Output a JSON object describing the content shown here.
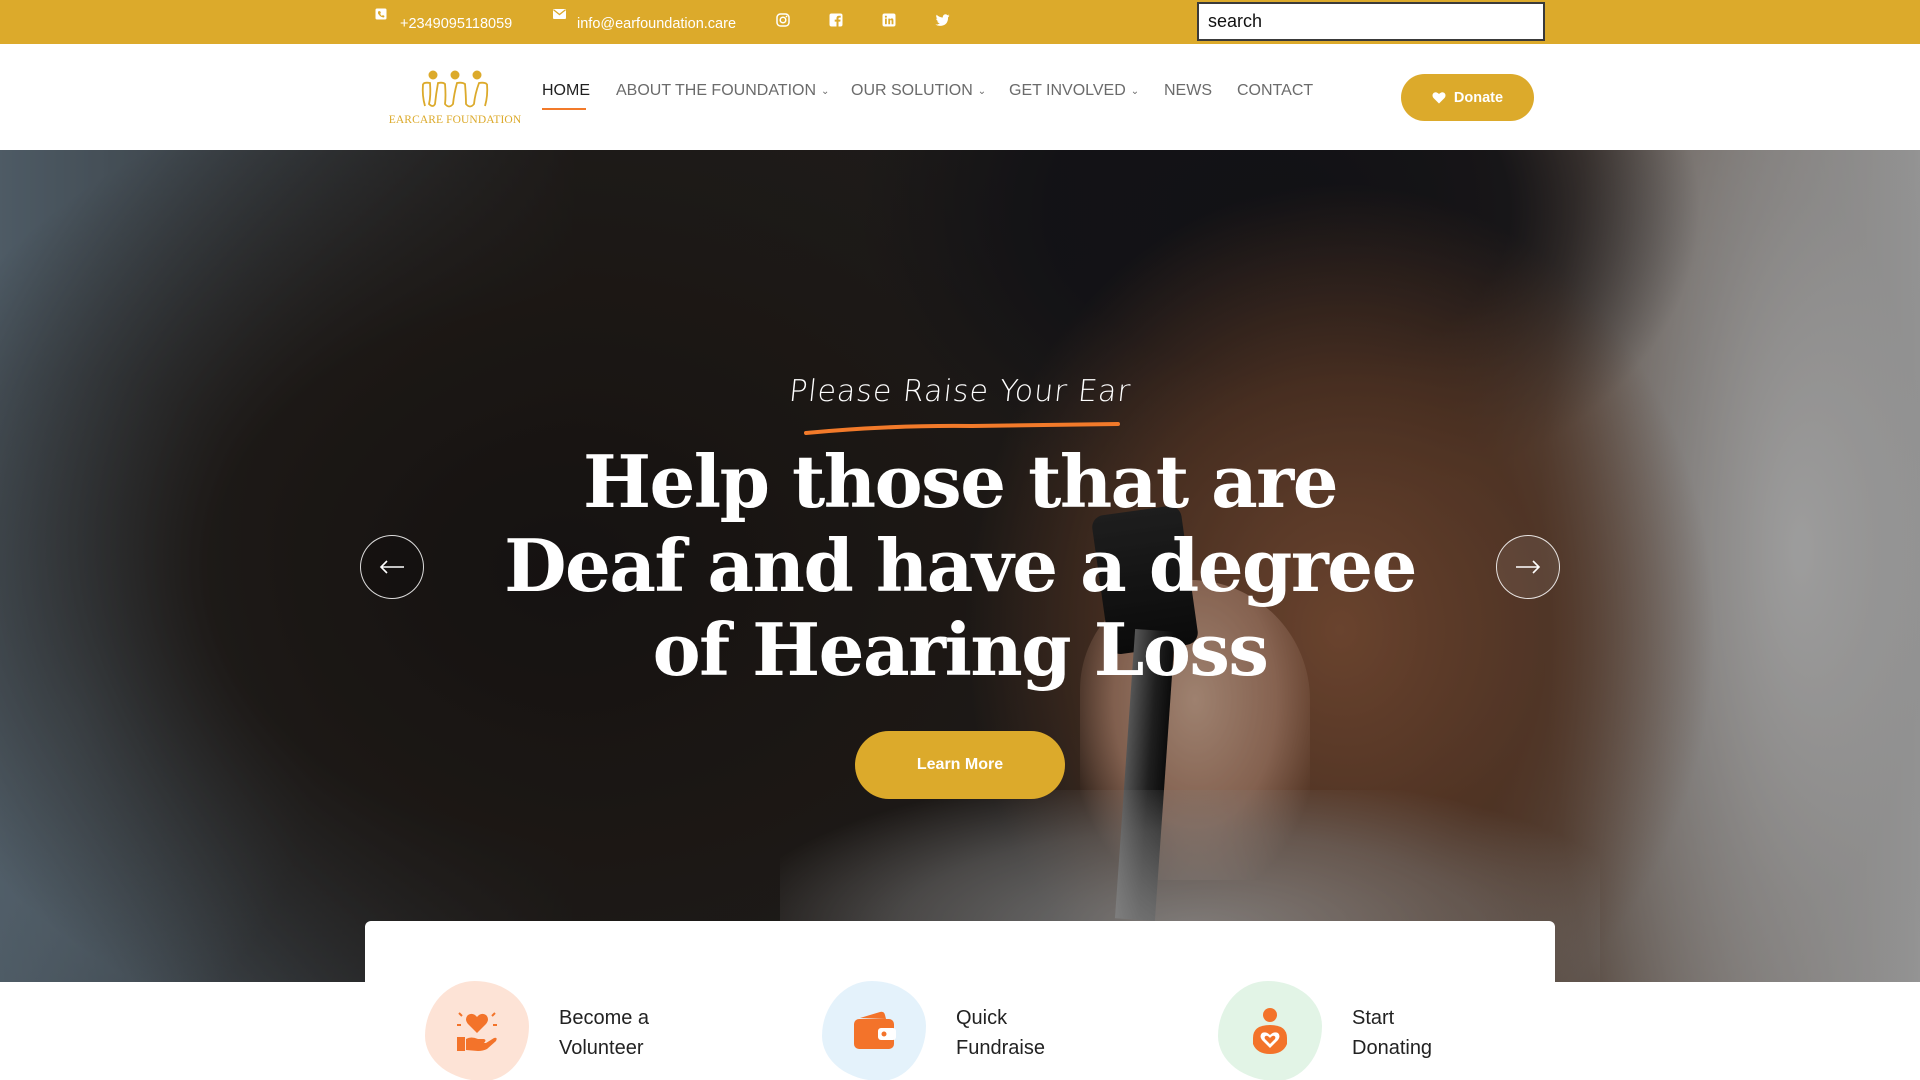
{
  "topbar": {
    "phone": "+2349095118059",
    "email": "info@earfoundation.care",
    "social": [
      "instagram-icon",
      "facebook-icon",
      "linkedin-icon",
      "twitter-icon"
    ],
    "search_value": "search"
  },
  "header": {
    "logo_text": "EARCARE FOUNDATION",
    "nav": [
      {
        "label": "HOME",
        "active": true
      },
      {
        "label": "ABOUT THE FOUNDATION",
        "dropdown": true
      },
      {
        "label": "OUR SOLUTION",
        "dropdown": true
      },
      {
        "label": "GET INVOLVED",
        "dropdown": true
      },
      {
        "label": "NEWS"
      },
      {
        "label": "CONTACT"
      }
    ],
    "donate_label": "Donate"
  },
  "hero": {
    "subtitle": "Please Raise Your Ear",
    "title_lines": [
      "Help those that are",
      "Deaf and have a degree",
      "of Hearing Loss"
    ],
    "button_label": "Learn More"
  },
  "cards": [
    {
      "line1": "Become a",
      "line2": "Volunteer",
      "icon": "volunteer-heart-hand-icon"
    },
    {
      "line1": "Quick",
      "line2": "Fundraise",
      "icon": "wallet-icon"
    },
    {
      "line1": "Start",
      "line2": "Donating",
      "icon": "person-heart-icon"
    }
  ],
  "colors": {
    "brand_gold": "#dcaa2b",
    "accent_orange": "#f27a2a",
    "text_dark": "#222222",
    "nav_gray": "#6b6b6b"
  }
}
